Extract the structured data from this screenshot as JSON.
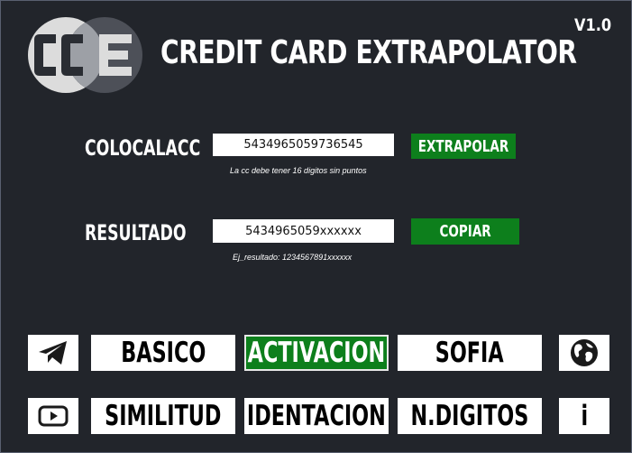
{
  "app": {
    "logo_text": "CCE",
    "title": "CREDIT CARD EXTRAPOLATOR",
    "version": "V1.0"
  },
  "input_section": {
    "label": "COLOCALACC",
    "value": "5434965059736545",
    "hint": "La cc debe tener 16 digitos sin puntos",
    "button_label": "EXTRAPOLAR"
  },
  "result_section": {
    "label": "RESULTADO",
    "value": "5434965059xxxxxx",
    "hint": "Ej_resultado: 1234567891xxxxxx",
    "button_label": "COPIAR"
  },
  "nav": {
    "row1": [
      "BASICO",
      "ACTIVACION",
      "SOFIA"
    ],
    "row2": [
      "SIMILITUD",
      "IDENTACION",
      "N.DIGITOS"
    ],
    "active": "ACTIVACION",
    "info_label": "i"
  },
  "icons": {
    "telegram": "telegram-icon",
    "globe": "globe-icon",
    "youtube": "youtube-icon",
    "info": "info-icon"
  },
  "colors": {
    "background": "#22252b",
    "accent_green": "#0d7f1c",
    "button_white": "#ffffff"
  }
}
